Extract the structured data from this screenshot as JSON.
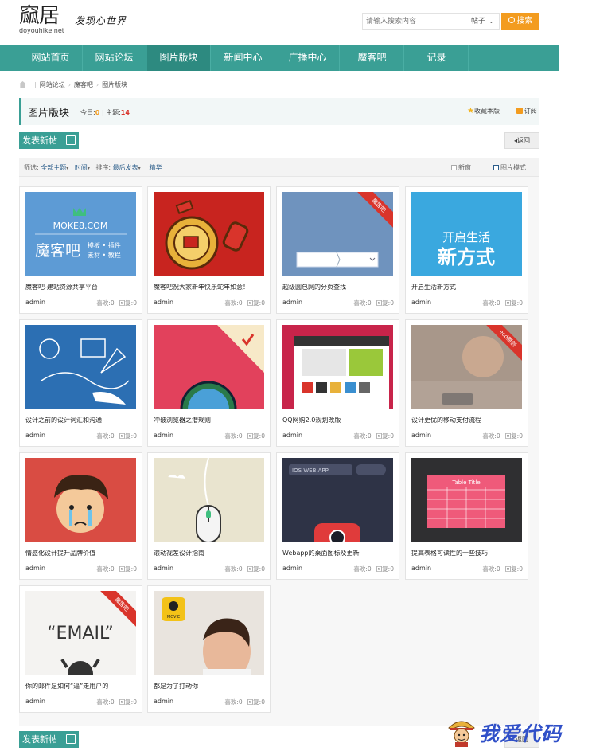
{
  "header": {
    "logo_text": "窳居",
    "logo_domain": "doyouhike.net",
    "slogan": "发现心世界",
    "search_placeholder": "请输入搜索内容",
    "search_type": "帖子",
    "search_button": "搜索"
  },
  "nav": {
    "items": [
      {
        "label": "网站首页"
      },
      {
        "label": "网站论坛"
      },
      {
        "label": "图片版块"
      },
      {
        "label": "新闻中心"
      },
      {
        "label": "广播中心"
      },
      {
        "label": "魔客吧"
      },
      {
        "label": "记录"
      }
    ],
    "active_index": 2
  },
  "breadcrumb": [
    "网站论坛",
    "魔客吧",
    "图片版块"
  ],
  "forum": {
    "title": "图片版块",
    "today_label": "今日:",
    "today_value": "0",
    "topics_label": "主题:",
    "topics_value": "14",
    "favorite": "收藏本版",
    "subscribe": "订阅"
  },
  "actions": {
    "new_post": "发表新帖",
    "back": "返回"
  },
  "filter": {
    "label": "筛选:",
    "all_topics": "全部主题",
    "time": "时间",
    "sort_label": "排序:",
    "sort_value": "最后发表",
    "digest": "精华",
    "new_window": "新窗",
    "picture_mode": "图片模式"
  },
  "likes_label": "喜欢:",
  "replies_label": "回复:",
  "posts": [
    {
      "title": "魔客吧-建站资源共享平台",
      "author": "admin",
      "likes": "0",
      "replies": "0",
      "thumb_color": "#5d9bd5",
      "ribbon": ""
    },
    {
      "title": "魔客吧祝大家新年快乐蛇年如意！",
      "author": "admin",
      "likes": "0",
      "replies": "0",
      "thumb_color": "#c8241f",
      "ribbon": ""
    },
    {
      "title": "超级圆包网的分页查找",
      "author": "admin",
      "likes": "0",
      "replies": "0",
      "thumb_color": "#6f93be",
      "ribbon": "魔客吧"
    },
    {
      "title": "开启生活新方式",
      "author": "admin",
      "likes": "0",
      "replies": "0",
      "thumb_color": "#3aa8df",
      "ribbon": ""
    },
    {
      "title": "设计之前的设计词汇和沟通",
      "author": "admin",
      "likes": "0",
      "replies": "0",
      "thumb_color": "#2c6fb3",
      "ribbon": ""
    },
    {
      "title": "冲破浏览器之潜规则",
      "author": "admin",
      "likes": "0",
      "replies": "0",
      "thumb_color": "#e2415c",
      "ribbon": ""
    },
    {
      "title": "QQ网购2.0规划改版",
      "author": "admin",
      "likes": "0",
      "replies": "0",
      "thumb_color": "#c8244a",
      "ribbon": ""
    },
    {
      "title": "设计更优的移动支付流程",
      "author": "admin",
      "likes": "0",
      "replies": "0",
      "thumb_color": "#a8978a",
      "ribbon": "ecd原创"
    },
    {
      "title": "情感化设计提升品牌价值",
      "author": "admin",
      "likes": "0",
      "replies": "0",
      "thumb_color": "#d94c43",
      "ribbon": ""
    },
    {
      "title": "滚动视差设计指南",
      "author": "admin",
      "likes": "0",
      "replies": "0",
      "thumb_color": "#e9e4cf",
      "ribbon": ""
    },
    {
      "title": "Webapp的桌面图标及更新",
      "author": "admin",
      "likes": "0",
      "replies": "0",
      "thumb_color": "#2e3346",
      "ribbon": ""
    },
    {
      "title": "提高表格可读性的一些技巧",
      "author": "admin",
      "likes": "0",
      "replies": "0",
      "thumb_color": "#2f2f31",
      "ribbon": ""
    },
    {
      "title": "你的邮件是如何“逼”走用户的",
      "author": "admin",
      "likes": "0",
      "replies": "0",
      "thumb_color": "#f4f3f1",
      "ribbon": "魔客吧"
    },
    {
      "title": "都是为了打动你",
      "author": "admin",
      "likes": "0",
      "replies": "0",
      "thumb_color": "#e9e4de",
      "ribbon": ""
    }
  ],
  "thumb_text": {
    "moke_site": "MOKE8.COM",
    "moke_name": "魔客吧",
    "moke_tags1": "模板 • 插件",
    "moke_tags2": "素材 • 教程",
    "life1": "开启生活",
    "life2": "新方式",
    "webapp": "IOS WEB APP",
    "table_title": "Table Title",
    "email": "“EMAIL”",
    "movie": "MOVIE"
  },
  "watermark": "我爱代码",
  "colors": {
    "accent": "#3a9f95",
    "orange": "#f39c1f",
    "nav_bg": "#3a9f95"
  }
}
